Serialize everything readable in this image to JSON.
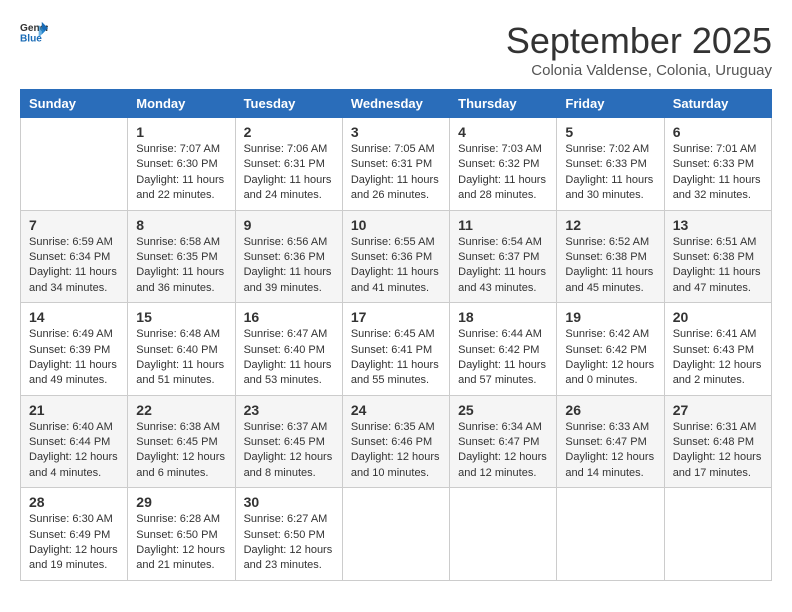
{
  "logo": {
    "general": "General",
    "blue": "Blue"
  },
  "header": {
    "month": "September 2025",
    "location": "Colonia Valdense, Colonia, Uruguay"
  },
  "days_of_week": [
    "Sunday",
    "Monday",
    "Tuesday",
    "Wednesday",
    "Thursday",
    "Friday",
    "Saturday"
  ],
  "weeks": [
    [
      {
        "day": "",
        "sunrise": "",
        "sunset": "",
        "daylight": ""
      },
      {
        "day": "1",
        "sunrise": "Sunrise: 7:07 AM",
        "sunset": "Sunset: 6:30 PM",
        "daylight": "Daylight: 11 hours and 22 minutes."
      },
      {
        "day": "2",
        "sunrise": "Sunrise: 7:06 AM",
        "sunset": "Sunset: 6:31 PM",
        "daylight": "Daylight: 11 hours and 24 minutes."
      },
      {
        "day": "3",
        "sunrise": "Sunrise: 7:05 AM",
        "sunset": "Sunset: 6:31 PM",
        "daylight": "Daylight: 11 hours and 26 minutes."
      },
      {
        "day": "4",
        "sunrise": "Sunrise: 7:03 AM",
        "sunset": "Sunset: 6:32 PM",
        "daylight": "Daylight: 11 hours and 28 minutes."
      },
      {
        "day": "5",
        "sunrise": "Sunrise: 7:02 AM",
        "sunset": "Sunset: 6:33 PM",
        "daylight": "Daylight: 11 hours and 30 minutes."
      },
      {
        "day": "6",
        "sunrise": "Sunrise: 7:01 AM",
        "sunset": "Sunset: 6:33 PM",
        "daylight": "Daylight: 11 hours and 32 minutes."
      }
    ],
    [
      {
        "day": "7",
        "sunrise": "Sunrise: 6:59 AM",
        "sunset": "Sunset: 6:34 PM",
        "daylight": "Daylight: 11 hours and 34 minutes."
      },
      {
        "day": "8",
        "sunrise": "Sunrise: 6:58 AM",
        "sunset": "Sunset: 6:35 PM",
        "daylight": "Daylight: 11 hours and 36 minutes."
      },
      {
        "day": "9",
        "sunrise": "Sunrise: 6:56 AM",
        "sunset": "Sunset: 6:36 PM",
        "daylight": "Daylight: 11 hours and 39 minutes."
      },
      {
        "day": "10",
        "sunrise": "Sunrise: 6:55 AM",
        "sunset": "Sunset: 6:36 PM",
        "daylight": "Daylight: 11 hours and 41 minutes."
      },
      {
        "day": "11",
        "sunrise": "Sunrise: 6:54 AM",
        "sunset": "Sunset: 6:37 PM",
        "daylight": "Daylight: 11 hours and 43 minutes."
      },
      {
        "day": "12",
        "sunrise": "Sunrise: 6:52 AM",
        "sunset": "Sunset: 6:38 PM",
        "daylight": "Daylight: 11 hours and 45 minutes."
      },
      {
        "day": "13",
        "sunrise": "Sunrise: 6:51 AM",
        "sunset": "Sunset: 6:38 PM",
        "daylight": "Daylight: 11 hours and 47 minutes."
      }
    ],
    [
      {
        "day": "14",
        "sunrise": "Sunrise: 6:49 AM",
        "sunset": "Sunset: 6:39 PM",
        "daylight": "Daylight: 11 hours and 49 minutes."
      },
      {
        "day": "15",
        "sunrise": "Sunrise: 6:48 AM",
        "sunset": "Sunset: 6:40 PM",
        "daylight": "Daylight: 11 hours and 51 minutes."
      },
      {
        "day": "16",
        "sunrise": "Sunrise: 6:47 AM",
        "sunset": "Sunset: 6:40 PM",
        "daylight": "Daylight: 11 hours and 53 minutes."
      },
      {
        "day": "17",
        "sunrise": "Sunrise: 6:45 AM",
        "sunset": "Sunset: 6:41 PM",
        "daylight": "Daylight: 11 hours and 55 minutes."
      },
      {
        "day": "18",
        "sunrise": "Sunrise: 6:44 AM",
        "sunset": "Sunset: 6:42 PM",
        "daylight": "Daylight: 11 hours and 57 minutes."
      },
      {
        "day": "19",
        "sunrise": "Sunrise: 6:42 AM",
        "sunset": "Sunset: 6:42 PM",
        "daylight": "Daylight: 12 hours and 0 minutes."
      },
      {
        "day": "20",
        "sunrise": "Sunrise: 6:41 AM",
        "sunset": "Sunset: 6:43 PM",
        "daylight": "Daylight: 12 hours and 2 minutes."
      }
    ],
    [
      {
        "day": "21",
        "sunrise": "Sunrise: 6:40 AM",
        "sunset": "Sunset: 6:44 PM",
        "daylight": "Daylight: 12 hours and 4 minutes."
      },
      {
        "day": "22",
        "sunrise": "Sunrise: 6:38 AM",
        "sunset": "Sunset: 6:45 PM",
        "daylight": "Daylight: 12 hours and 6 minutes."
      },
      {
        "day": "23",
        "sunrise": "Sunrise: 6:37 AM",
        "sunset": "Sunset: 6:45 PM",
        "daylight": "Daylight: 12 hours and 8 minutes."
      },
      {
        "day": "24",
        "sunrise": "Sunrise: 6:35 AM",
        "sunset": "Sunset: 6:46 PM",
        "daylight": "Daylight: 12 hours and 10 minutes."
      },
      {
        "day": "25",
        "sunrise": "Sunrise: 6:34 AM",
        "sunset": "Sunset: 6:47 PM",
        "daylight": "Daylight: 12 hours and 12 minutes."
      },
      {
        "day": "26",
        "sunrise": "Sunrise: 6:33 AM",
        "sunset": "Sunset: 6:47 PM",
        "daylight": "Daylight: 12 hours and 14 minutes."
      },
      {
        "day": "27",
        "sunrise": "Sunrise: 6:31 AM",
        "sunset": "Sunset: 6:48 PM",
        "daylight": "Daylight: 12 hours and 17 minutes."
      }
    ],
    [
      {
        "day": "28",
        "sunrise": "Sunrise: 6:30 AM",
        "sunset": "Sunset: 6:49 PM",
        "daylight": "Daylight: 12 hours and 19 minutes."
      },
      {
        "day": "29",
        "sunrise": "Sunrise: 6:28 AM",
        "sunset": "Sunset: 6:50 PM",
        "daylight": "Daylight: 12 hours and 21 minutes."
      },
      {
        "day": "30",
        "sunrise": "Sunrise: 6:27 AM",
        "sunset": "Sunset: 6:50 PM",
        "daylight": "Daylight: 12 hours and 23 minutes."
      },
      {
        "day": "",
        "sunrise": "",
        "sunset": "",
        "daylight": ""
      },
      {
        "day": "",
        "sunrise": "",
        "sunset": "",
        "daylight": ""
      },
      {
        "day": "",
        "sunrise": "",
        "sunset": "",
        "daylight": ""
      },
      {
        "day": "",
        "sunrise": "",
        "sunset": "",
        "daylight": ""
      }
    ]
  ]
}
